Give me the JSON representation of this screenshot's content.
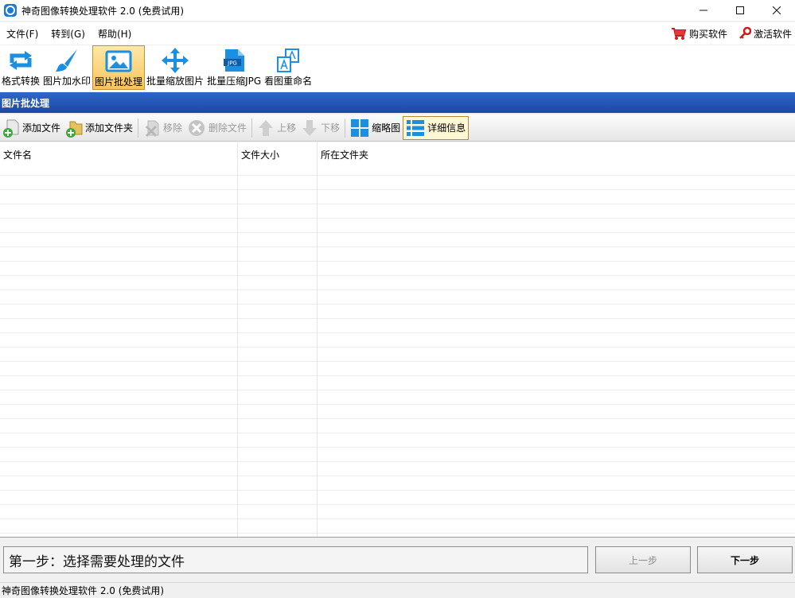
{
  "window": {
    "title": "神奇图像转换处理软件 2.0 (免费试用)",
    "controls": [
      "minimize",
      "maximize",
      "close"
    ]
  },
  "menu": {
    "items": [
      "文件(F)",
      "转到(G)",
      "帮助(H)"
    ],
    "buy_label": "购买软件",
    "activate_label": "激活软件"
  },
  "toolbar": {
    "tools": [
      {
        "label": "格式转换",
        "icon": "convert-arrows-icon"
      },
      {
        "label": "图片加水印",
        "icon": "brush-icon"
      },
      {
        "label": "图片批处理",
        "icon": "image-icon",
        "active": true
      },
      {
        "label": "批量缩放图片",
        "icon": "move-arrows-icon"
      },
      {
        "label": "批量压缩JPG",
        "icon": "jpg-file-icon"
      },
      {
        "label": "看图重命名",
        "icon": "rename-icon"
      }
    ]
  },
  "section": {
    "title": "图片批处理"
  },
  "subtoolbar": {
    "add_file": "添加文件",
    "add_folder": "添加文件夹",
    "remove": "移除",
    "delete_file": "删除文件",
    "move_up": "上移",
    "move_down": "下移",
    "thumbnail": "缩略图",
    "details": "详细信息"
  },
  "table": {
    "columns": [
      "文件名",
      "文件大小",
      "所在文件夹"
    ],
    "rows": []
  },
  "bottom": {
    "step_text": "第一步：选择需要处理的文件",
    "prev_label": "上一步",
    "next_label": "下一步"
  },
  "status": {
    "text": "神奇图像转换处理软件 2.0 (免费试用)"
  },
  "colors": {
    "accent_blue": "#1e78d8",
    "header_blue": "#2f66c8",
    "active_tool": "#f7c35a"
  }
}
